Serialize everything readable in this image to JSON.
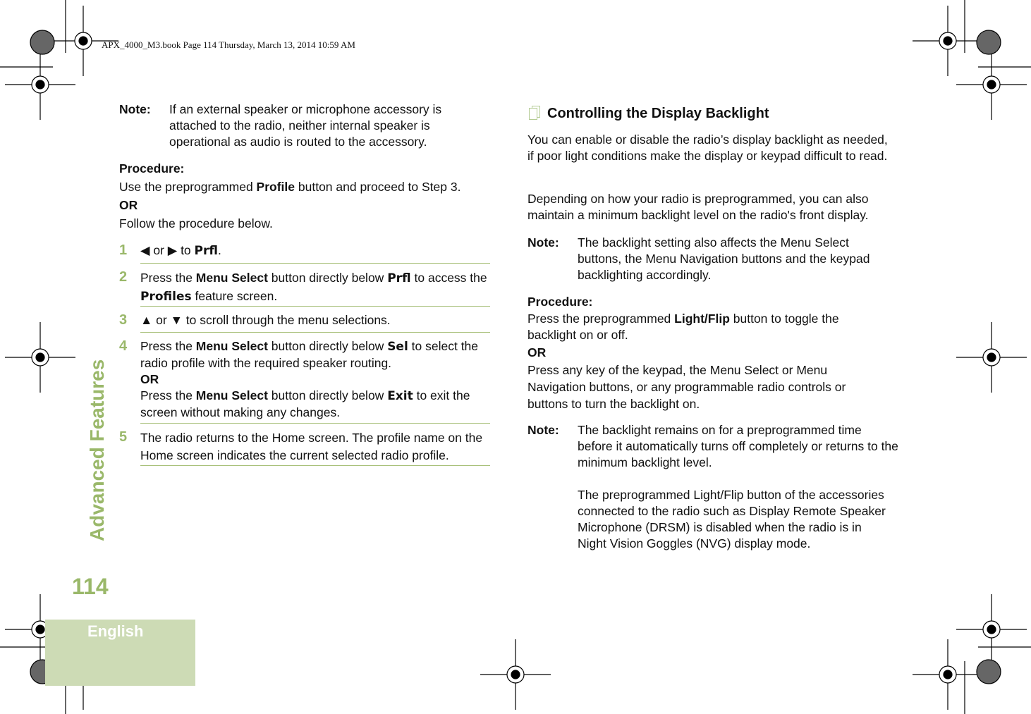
{
  "header": "APX_4000_M3.book  Page 114  Thursday, March 13, 2014  10:59 AM",
  "sidebar": {
    "section": "Advanced Features",
    "page_number": "114",
    "language": "English"
  },
  "left": {
    "note_label": "Note:",
    "note_text": "If an external speaker or microphone accessory is attached to the radio, neither internal speaker is operational as audio is routed to the accessory.",
    "procedure_label": "Procedure:",
    "proc_a": "Use the preprogrammed ",
    "proc_b": "Profile",
    "proc_c": " button and proceed to Step 3.",
    "or": "OR",
    "follow": "Follow the procedure below.",
    "steps": [
      {
        "num": "1",
        "a": "◀ or ▶ to ",
        "d1": "Prfl",
        "b": "."
      },
      {
        "num": "2",
        "a": "Press the ",
        "bold": "Menu Select",
        "b": " button directly below ",
        "d1": "Prfl",
        "c": " to access the ",
        "d2": "Profiles",
        "e": " feature screen."
      },
      {
        "num": "3",
        "a": "▲ or ▼ to scroll through the menu selections."
      },
      {
        "num": "4",
        "a": "Press the ",
        "bold": "Menu Select",
        "b": " button directly below ",
        "d1": "Sel",
        "c": " to select the radio profile with the required speaker routing.",
        "or": "OR",
        "f": "Press the ",
        "bold2": "Menu Select",
        "g": " button directly below ",
        "d2": "Exit",
        "h": " to exit the screen without making any changes."
      },
      {
        "num": "5",
        "a": "The radio returns to the Home screen. The profile name on the Home screen indicates the current selected radio profile."
      }
    ]
  },
  "right": {
    "title": "Controlling the Display Backlight",
    "p1": "You can enable or disable the radio’s display backlight as needed, if poor light conditions make the display or keypad difficult to read.",
    "p2": "Depending on how your radio is preprogrammed, you can also maintain a minimum backlight level on the radio's front display.",
    "note1_label": "Note:",
    "note1": "The backlight setting also affects the Menu Select buttons, the Menu Navigation buttons and the keypad backlighting accordingly.",
    "procedure_label": "Procedure:",
    "proc_a": "Press the preprogrammed ",
    "proc_b": "Light/Flip",
    "proc_c": " button to toggle the backlight on or off.",
    "or": "OR",
    "proc2": "Press any key of the keypad, the Menu Select or Menu Navigation buttons, or any programmable radio controls or buttons to turn the backlight on.",
    "note2_label": "Note:",
    "note2a": "The backlight remains on for a preprogrammed time before it automatically turns off completely or returns to the minimum backlight level.",
    "note2b": "The preprogrammed Light/Flip button of the accessories connected to the radio such as Display Remote Speaker Microphone (DRSM) is disabled when the radio is in Night Vision Goggles (NVG) display mode."
  },
  "colors": {
    "accent": "#9ab86a",
    "tab": "#cddbb5",
    "rule": "#a8c07a"
  }
}
